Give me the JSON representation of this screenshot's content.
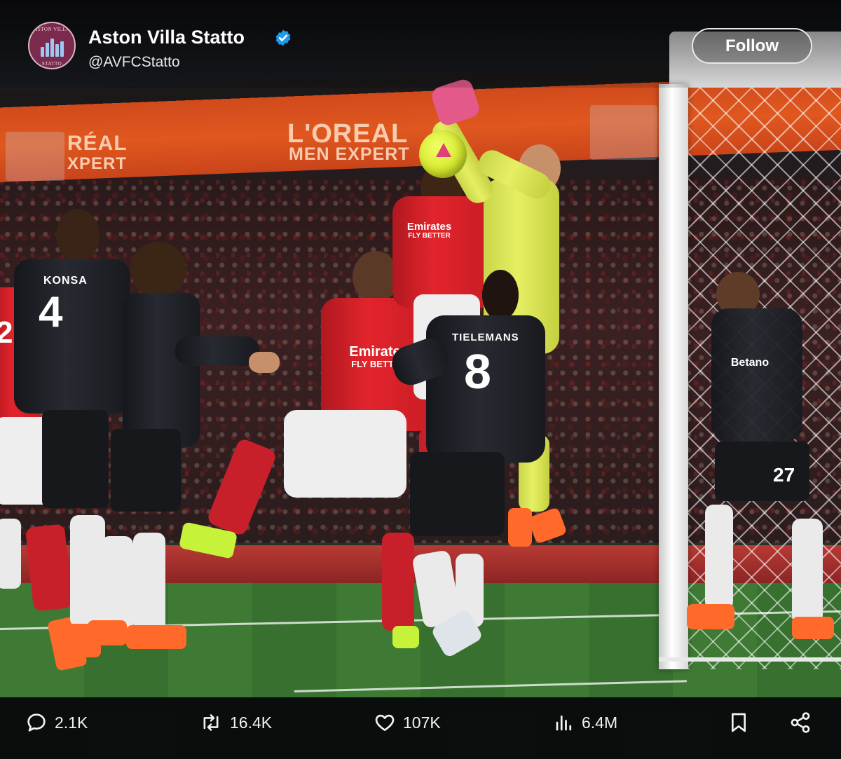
{
  "post": {
    "display_name": "Aston Villa Statto",
    "handle": "@AVFCStatto",
    "follow_label": "Follow",
    "avatar_text_top": "ASTON VILLA",
    "avatar_text_bottom": "STATTO"
  },
  "photo": {
    "banner_center_line1": "L'OREAL",
    "banner_center_line2": "MEN EXPERT",
    "banner_left_partial1": "RÉAL",
    "banner_left_partial2": "XPERT",
    "players": {
      "konsa_name": "KONSA",
      "konsa_number": "4",
      "tielemans_name": "TIELEMANS",
      "tielemans_number": "8",
      "arsenal_sponsor_line1": "Emirates",
      "arsenal_sponsor_line2": "FLY BETTER",
      "villa_sponsor": "Betano",
      "villa_back_number": "27",
      "left_edge_number": "2"
    }
  },
  "actions": {
    "replies": "2.1K",
    "reposts": "16.4K",
    "likes": "107K",
    "views": "6.4M"
  },
  "icons": {
    "verified_color": "#1d9bf0"
  }
}
